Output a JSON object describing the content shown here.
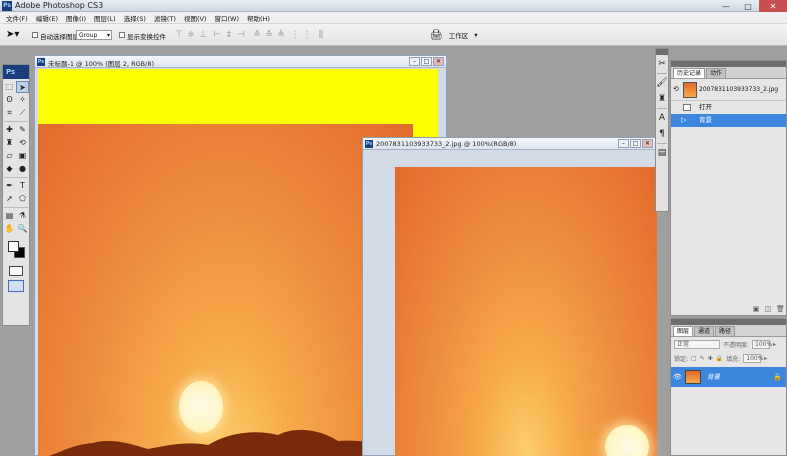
{
  "app": {
    "title": "Adobe Photoshop CS3",
    "icon": "Ps"
  },
  "menu": [
    "文件(F)",
    "编辑(E)",
    "图像(I)",
    "图层(L)",
    "选择(S)",
    "滤镜(T)",
    "视图(V)",
    "窗口(W)",
    "帮助(H)"
  ],
  "options": {
    "auto_select_label": "自动选择图层",
    "group_value": "Group",
    "show_transform_label": "显示变换控件",
    "workspace_label": "工作区"
  },
  "toolbox": {
    "logo": "Ps"
  },
  "doc1": {
    "title": "未标题-1 @ 100% (图层 2, RGB/8)"
  },
  "doc2": {
    "title": "20078311039337​33_2.jpg @ 100%(RGB/8)"
  },
  "history": {
    "tabs": [
      "历史记录",
      "动作"
    ],
    "snapshot": "20078311039337​33_2.jpg",
    "items": [
      "打开",
      "背景"
    ]
  },
  "layers": {
    "tabs": [
      "图层",
      "通道",
      "路径"
    ],
    "blend_mode": "正常",
    "opacity_label": "不透明度:",
    "opacity_value": "100%",
    "lock_label": "锁定:",
    "fill_label": "填充:",
    "fill_value": "100%",
    "layer_name": "背景"
  },
  "colors": {
    "accent": "#3d86e0",
    "canvas_yellow": "#ffff00"
  }
}
